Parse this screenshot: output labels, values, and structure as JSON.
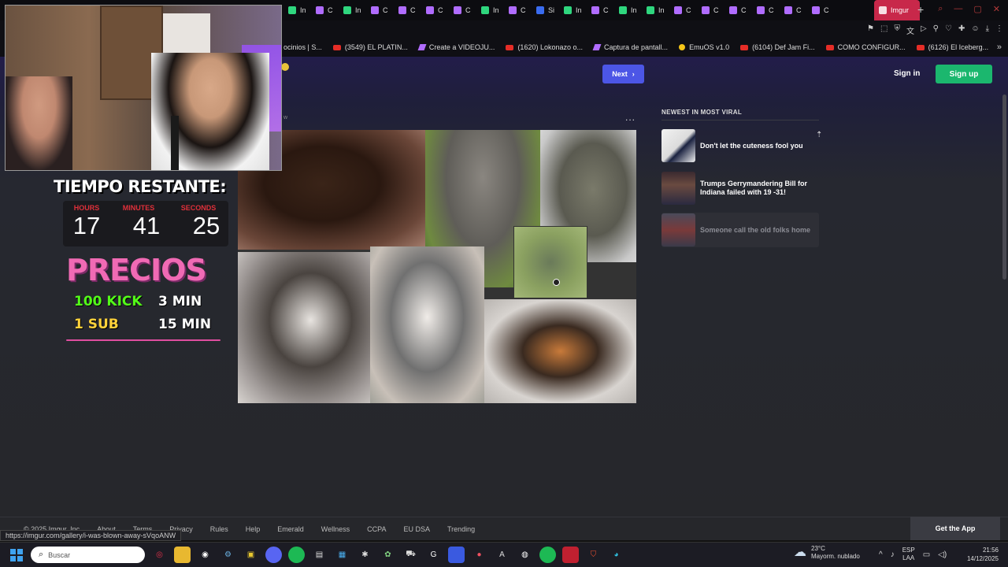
{
  "browser": {
    "tabs": [
      {
        "label": "In",
        "color": "#2fd67e"
      },
      {
        "label": "C",
        "color": "#b06cff"
      },
      {
        "label": "In",
        "color": "#2fd67e"
      },
      {
        "label": "C",
        "color": "#b06cff"
      },
      {
        "label": "C",
        "color": "#b06cff"
      },
      {
        "label": "C",
        "color": "#b06cff"
      },
      {
        "label": "C",
        "color": "#b06cff"
      },
      {
        "label": "In",
        "color": "#2fd67e"
      },
      {
        "label": "C",
        "color": "#b06cff"
      },
      {
        "label": "Si",
        "color": "#3a6cf0"
      },
      {
        "label": "In",
        "color": "#2fd67e"
      },
      {
        "label": "C",
        "color": "#b06cff"
      },
      {
        "label": "In",
        "color": "#2fd67e"
      },
      {
        "label": "In",
        "color": "#2fd67e"
      },
      {
        "label": "C",
        "color": "#b06cff"
      },
      {
        "label": "C",
        "color": "#b06cff"
      },
      {
        "label": "C",
        "color": "#b06cff"
      },
      {
        "label": "C",
        "color": "#b06cff"
      },
      {
        "label": "C",
        "color": "#b06cff"
      },
      {
        "label": "C",
        "color": "#b06cff"
      }
    ],
    "active_tab": "Imgur",
    "new_tab": "+",
    "bookmarks": [
      {
        "label": "ocinios | S...",
        "icon": "none"
      },
      {
        "label": "(3549) EL PLATIN...",
        "icon": "youtube"
      },
      {
        "label": "Create a VIDEOJU...",
        "icon": "pen"
      },
      {
        "label": "(1620) Lokonazo o...",
        "icon": "youtube"
      },
      {
        "label": "Captura de pantall...",
        "icon": "pen"
      },
      {
        "label": "EmuOS v1.0",
        "icon": "coin"
      },
      {
        "label": "(6104) Def Jam Fi...",
        "icon": "youtube"
      },
      {
        "label": "COMO CONFIGUR...",
        "icon": "youtube"
      },
      {
        "label": "(6126) El Iceberg...",
        "icon": "youtube"
      }
    ],
    "status_url": "https://imgur.com/gallery/i-was-blown-away-sVqoANW"
  },
  "imgur": {
    "next_label": "Next",
    "sign_in": "Sign in",
    "sign_up": "Sign up",
    "post_menu": "...",
    "post_sub": "w",
    "sidebar_title": "NEWEST IN MOST VIRAL",
    "sidebar_items": [
      {
        "title": "Don't let the cuteness fool you"
      },
      {
        "title": "Trumps Gerrymandering Bill for Indiana failed with 19 -31!"
      },
      {
        "title": "Someone call the old folks home"
      }
    ],
    "footer_links": [
      "© 2025 Imgur, Inc",
      "About",
      "Terms",
      "Privacy",
      "Rules",
      "Help",
      "Emerald",
      "Wellness",
      "CCPA",
      "EU DSA",
      "Trending"
    ],
    "get_app": "Get the App"
  },
  "overlay": {
    "title": "TIEMPO RESTANTE:",
    "hours_label": "HOURS",
    "minutes_label": "MINUTES",
    "seconds_label": "SECONDS",
    "hours": "17",
    "minutes": "41",
    "seconds": "25",
    "precios": "PRECIOS",
    "row1_left": "100 KICK",
    "row1_right": "3 MIN",
    "row2_left": "1 SUB",
    "row2_right": "15 MIN"
  },
  "taskbar": {
    "search_placeholder": "Buscar",
    "weather_temp": "23°C",
    "weather_desc": "Mayorm. nublado",
    "lang_top": "ESP",
    "lang_bottom": "LAA",
    "time": "21:56",
    "date": "14/12/2025"
  },
  "colors": {
    "accent_next": "#4c56e6",
    "accent_signup": "#1bb76e",
    "active_tab": "#c8284a",
    "precios_pink": "#f06ab4",
    "kick_green": "#53fc18",
    "sub_yellow": "#ffd23a"
  }
}
